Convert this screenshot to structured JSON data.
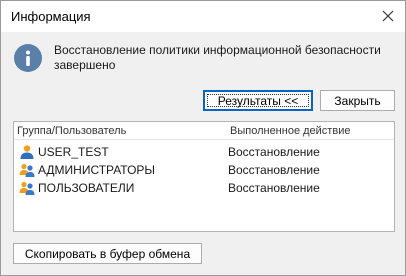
{
  "window": {
    "title": "Информация"
  },
  "message": {
    "text": "Восстановление политики информационной безопасности завершено",
    "icon": "info-icon"
  },
  "buttons": {
    "results_label": "Результаты <<",
    "close_label": "Закрыть",
    "copy_label": "Скопировать в буфер обмена"
  },
  "table": {
    "columns": [
      "Группа/Пользователь",
      "Выполненное действие"
    ],
    "rows": [
      {
        "name": "USER_TEST",
        "action": "Восстановление",
        "icon": "user-icon"
      },
      {
        "name": "АДМИНИСТРАТОРЫ",
        "action": "Восстановление",
        "icon": "group-icon"
      },
      {
        "name": "ПОЛЬЗОВАТЕЛИ",
        "action": "Восстановление",
        "icon": "group-icon"
      }
    ]
  },
  "colors": {
    "info_icon": "#5a7fa8",
    "user_icon": "#f0a020",
    "group_icon_secondary": "#3a78c8",
    "focus_border": "#0a64c8"
  }
}
